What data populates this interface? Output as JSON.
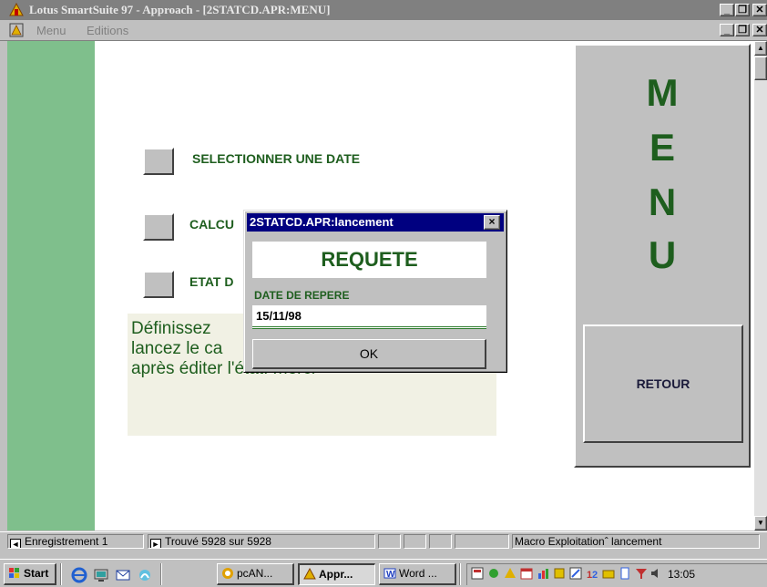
{
  "window": {
    "title": "Lotus SmartSuite 97   - Approach - [2STATCD.APR:MENU]",
    "controls": {
      "minimize": "_",
      "restore": "̅̅",
      "close": "X"
    }
  },
  "menubar": {
    "items": [
      "Menu",
      "Editions"
    ]
  },
  "entries": [
    {
      "label": "SELECTIONNER UNE DATE"
    },
    {
      "label": "CALCU"
    },
    {
      "label": "ETAT D"
    }
  ],
  "info": {
    "line1": "Définissez",
    "line2": "lancez le ca",
    "line3": "après éditer l'état. merci"
  },
  "side_panel": {
    "letters": [
      "M",
      "E",
      "N",
      "U"
    ],
    "retour_label": "RETOUR"
  },
  "dialog": {
    "title": "2STATCD.APR:lancement",
    "close": "×",
    "heading": "REQUETE",
    "field_label": "DATE DE REPERE",
    "field_value": "15/11/98",
    "ok_label": "OK"
  },
  "statusbar": {
    "record": "Enregistrement 1",
    "found": "Trouvé 5928 sur 5928",
    "macro": "Macro Exploitationˆ lancement"
  },
  "taskbar": {
    "start": "Start",
    "tasks": [
      {
        "label": "pcAN..."
      },
      {
        "label": "Appr...",
        "active": true
      },
      {
        "label": "Word ..."
      }
    ],
    "clock": "13:05"
  },
  "colors": {
    "accent_green": "#1e5e1e",
    "left_band": "#7fbf8c",
    "dialog_title": "#000080"
  }
}
